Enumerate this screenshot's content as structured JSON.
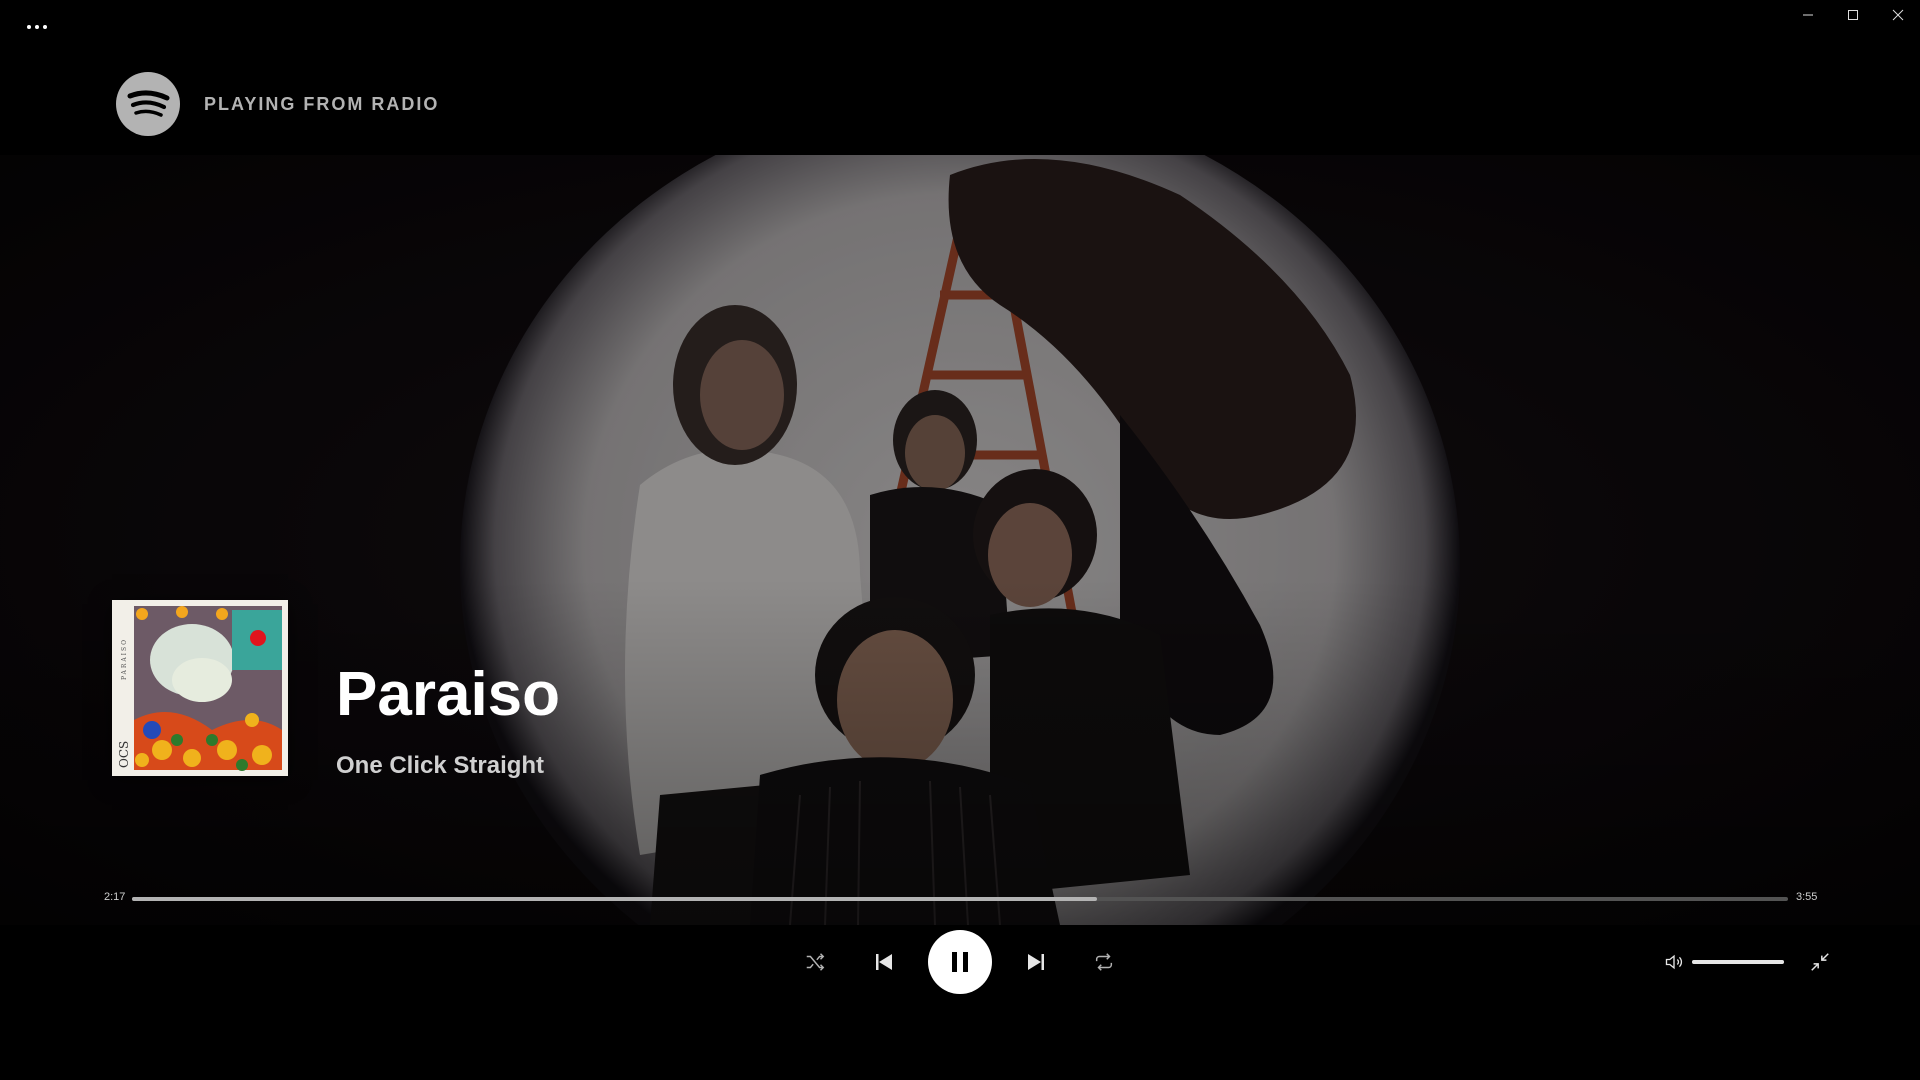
{
  "window": {
    "menu_icon": "more-horizontal-icon",
    "controls": [
      "minimize-icon",
      "maximize-icon",
      "close-icon"
    ]
  },
  "header": {
    "logo_icon": "spotify-logo-icon",
    "playing_from": "PLAYING FROM RADIO"
  },
  "track": {
    "title": "Paraiso",
    "artist": "One Click Straight"
  },
  "album_art": {
    "side_text_top": "PARAISO",
    "side_text_bottom": "OCS"
  },
  "playback": {
    "elapsed": "2:17",
    "duration": "3:55",
    "progress_fraction": 0.583
  },
  "controls": {
    "shuffle": "shuffle-icon",
    "previous": "skip-back-icon",
    "play_pause": "pause-icon",
    "next": "skip-forward-icon",
    "repeat": "repeat-icon"
  },
  "volume": {
    "icon": "volume-icon",
    "level_fraction": 1.0
  },
  "collapse_icon": "collapse-icon",
  "colors": {
    "background": "#000000",
    "text_primary": "#ffffff",
    "text_secondary": "#b3b3b3",
    "progress_bg": "#535353",
    "progress_fill": "#b3b3b3"
  }
}
